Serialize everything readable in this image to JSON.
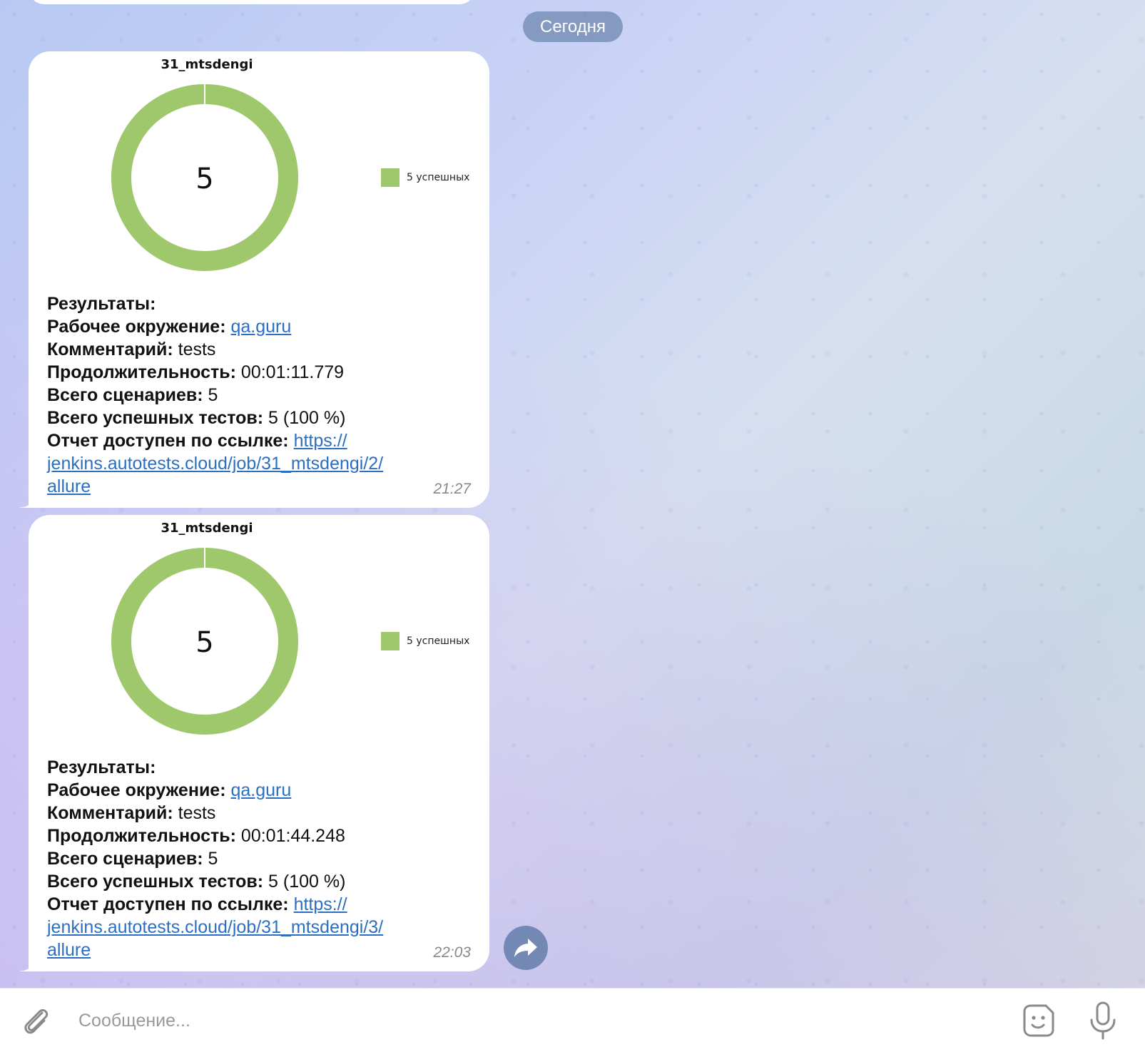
{
  "chat": {
    "date_label": "Сегодня"
  },
  "messages": [
    {
      "chart_data": {
        "type": "pie",
        "title": "31_mtsdengi",
        "center_label": "5",
        "slices": [
          {
            "name": "5 успешных",
            "value": 5,
            "color": "#9fc86c"
          }
        ],
        "legend_position": "right"
      },
      "results_title": "Результаты:",
      "environment_label": "Рабочее окружение:",
      "environment_value": "qa.guru",
      "comment_label": "Комментарий:",
      "comment_value": "tests",
      "duration_label": "Продолжительность:",
      "duration_value": "00:01:11.779",
      "scenarios_label": "Всего сценариев:",
      "scenarios_value": "5",
      "passed_label": "Всего успешных тестов:",
      "passed_value": "5 (100 %)",
      "report_label": "Отчет доступен по ссылке:",
      "report_link_line1": "https://",
      "report_link_line2": "jenkins.autotests.cloud/job/31_mtsdengi/2/",
      "report_link_line3": "allure",
      "time": "21:27"
    },
    {
      "chart_data": {
        "type": "pie",
        "title": "31_mtsdengi",
        "center_label": "5",
        "slices": [
          {
            "name": "5 успешных",
            "value": 5,
            "color": "#9fc86c"
          }
        ],
        "legend_position": "right"
      },
      "results_title": "Результаты:",
      "environment_label": "Рабочее окружение:",
      "environment_value": "qa.guru",
      "comment_label": "Комментарий:",
      "comment_value": "tests",
      "duration_label": "Продолжительность:",
      "duration_value": "00:01:44.248",
      "scenarios_label": "Всего сценариев:",
      "scenarios_value": "5",
      "passed_label": "Всего успешных тестов:",
      "passed_value": "5 (100 %)",
      "report_label": "Отчет доступен по ссылке:",
      "report_link_line1": "https://",
      "report_link_line2": "jenkins.autotests.cloud/job/31_mtsdengi/3/",
      "report_link_line3": "allure",
      "time": "22:03"
    }
  ],
  "composer": {
    "placeholder": "Сообщение...",
    "attach_icon": "paperclip-icon",
    "sticker_icon": "sticker-icon",
    "mic_icon": "microphone-icon"
  },
  "colors": {
    "link": "#2a6fc2",
    "success": "#9fc86c"
  }
}
